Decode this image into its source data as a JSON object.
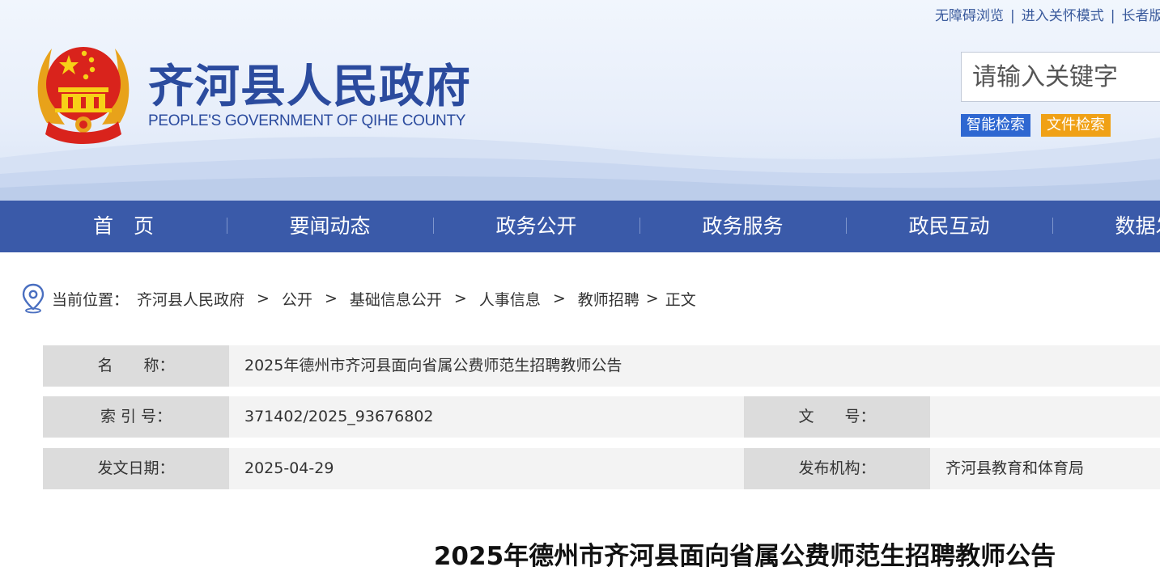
{
  "header": {
    "util_links": [
      "无障碍浏览",
      "进入关怀模式",
      "长者版"
    ],
    "title": "齐河县人民政府",
    "subtitle": "PEOPLE'S GOVERNMENT OF QIHE COUNTY",
    "search_placeholder": "请输入关键字",
    "smart_search": "智能检索",
    "doc_search": "文件检索"
  },
  "nav": {
    "items": [
      "首　页",
      "要闻动态",
      "政务公开",
      "政务服务",
      "政民互动",
      "数据发布"
    ]
  },
  "breadcrumb": {
    "prefix": "当前位置：",
    "items": [
      "齐河县人民政府",
      "公开",
      "基础信息公开",
      "人事信息",
      "教师招聘",
      "正文"
    ],
    "separator": ">"
  },
  "info": {
    "name_label": "名　　称：",
    "name_value": "2025年德州市齐河县面向省属公费师范生招聘教师公告",
    "index_label": "索 引 号：",
    "index_value": "371402/2025_93676802",
    "docno_label": "文　　号：",
    "docno_value": "",
    "date_label": "发文日期：",
    "date_value": "2025-04-29",
    "org_label": "发布机构：",
    "org_value": "齐河县教育和体育局"
  },
  "article": {
    "title": "2025年德州市齐河县面向省属公费师范生招聘教师公告"
  },
  "colors": {
    "nav_bg": "#3a5aa9",
    "title_blue": "#2b4b9e",
    "smart_btn": "#2e67d1",
    "doc_btn": "#f0a116"
  }
}
